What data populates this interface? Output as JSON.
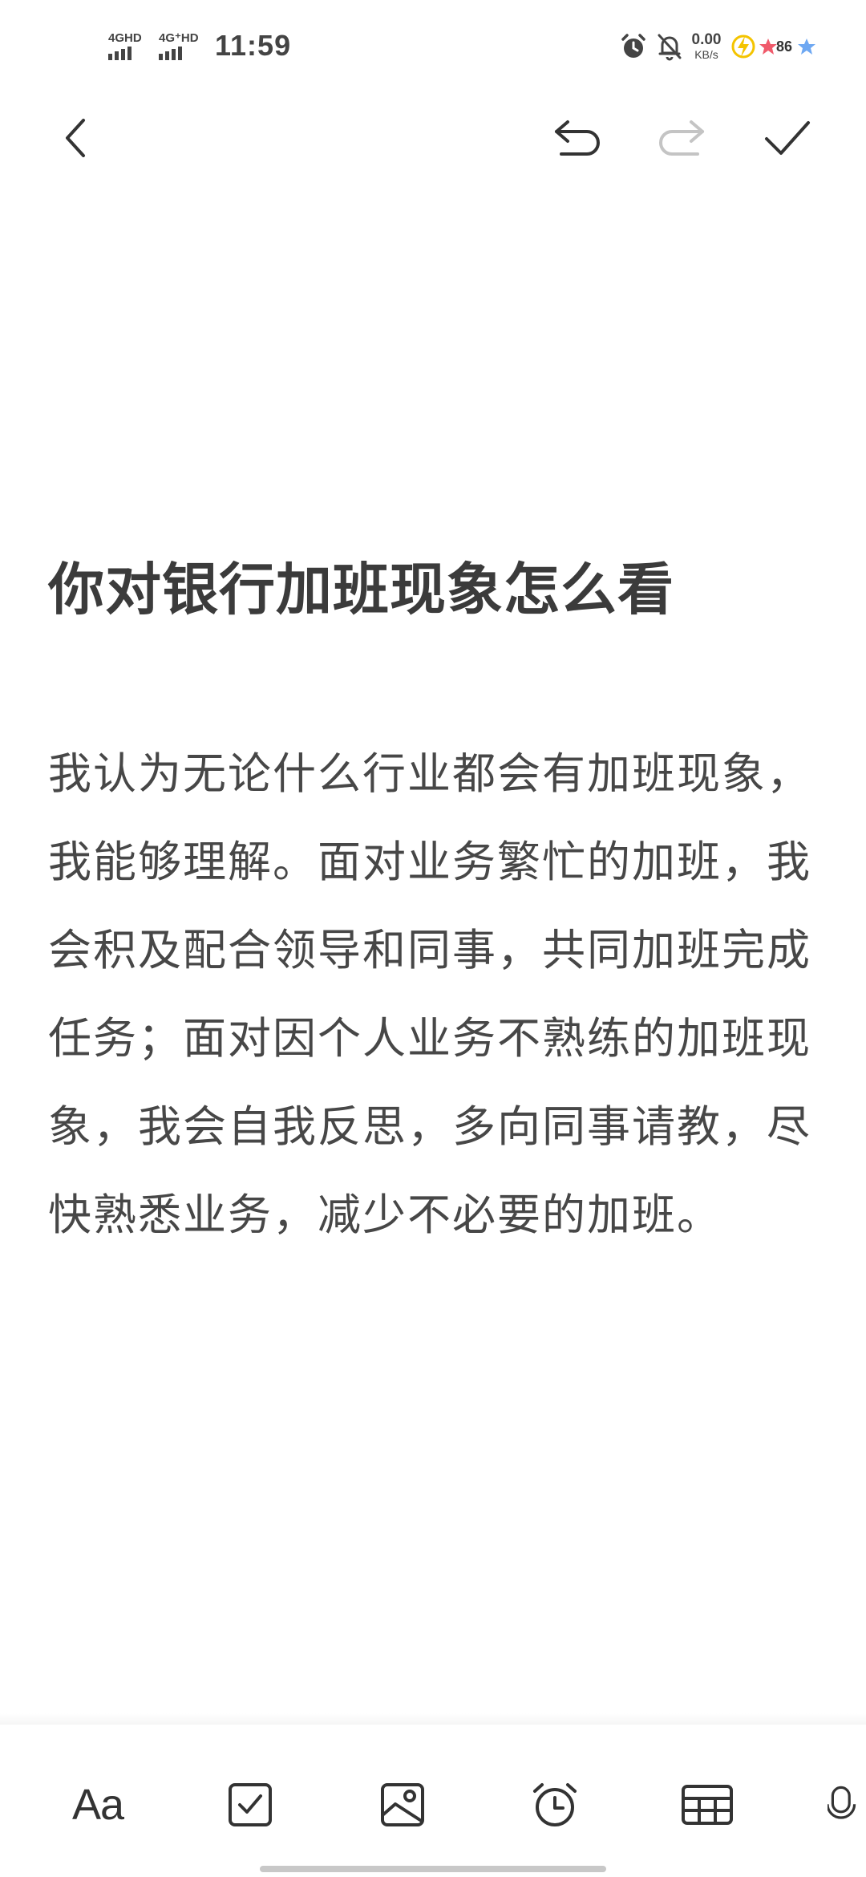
{
  "status_bar": {
    "sim1_label": "4GHD",
    "sim2_label": "4G⁺HD",
    "time": "11:59",
    "net_speed_value": "0.00",
    "net_speed_unit": "KB/s",
    "battery_level": "86",
    "icons": [
      "alarm-icon",
      "bell-off-icon",
      "charging-bolt-icon",
      "star-icon"
    ]
  },
  "toolbar": {
    "back_icon": "chevron-left-icon",
    "undo_icon": "undo-icon",
    "redo_icon": "redo-icon",
    "done_icon": "checkmark-icon",
    "redo_enabled": false
  },
  "note": {
    "title": "你对银行加班现象怎么看",
    "body": "我认为无论什么行业都会有加班现象，我能够理解。面对业务繁忙的加班，我会积及配合领导和同事，共同加班完成任务；面对因个人业务不熟练的加班现象，我会自我反思，多向同事请教，尽快熟悉业务，减少不必要的加班。"
  },
  "bottom_toolbar": {
    "text_format_label": "Aa",
    "items": [
      "text-format",
      "checkbox-icon",
      "image-icon",
      "alarm-icon",
      "table-icon",
      "microphone-icon"
    ]
  },
  "colors": {
    "background": "#ffffff",
    "text": "#3b3b3b",
    "icon": "#333333",
    "disabled_icon": "#c4c4c4"
  }
}
